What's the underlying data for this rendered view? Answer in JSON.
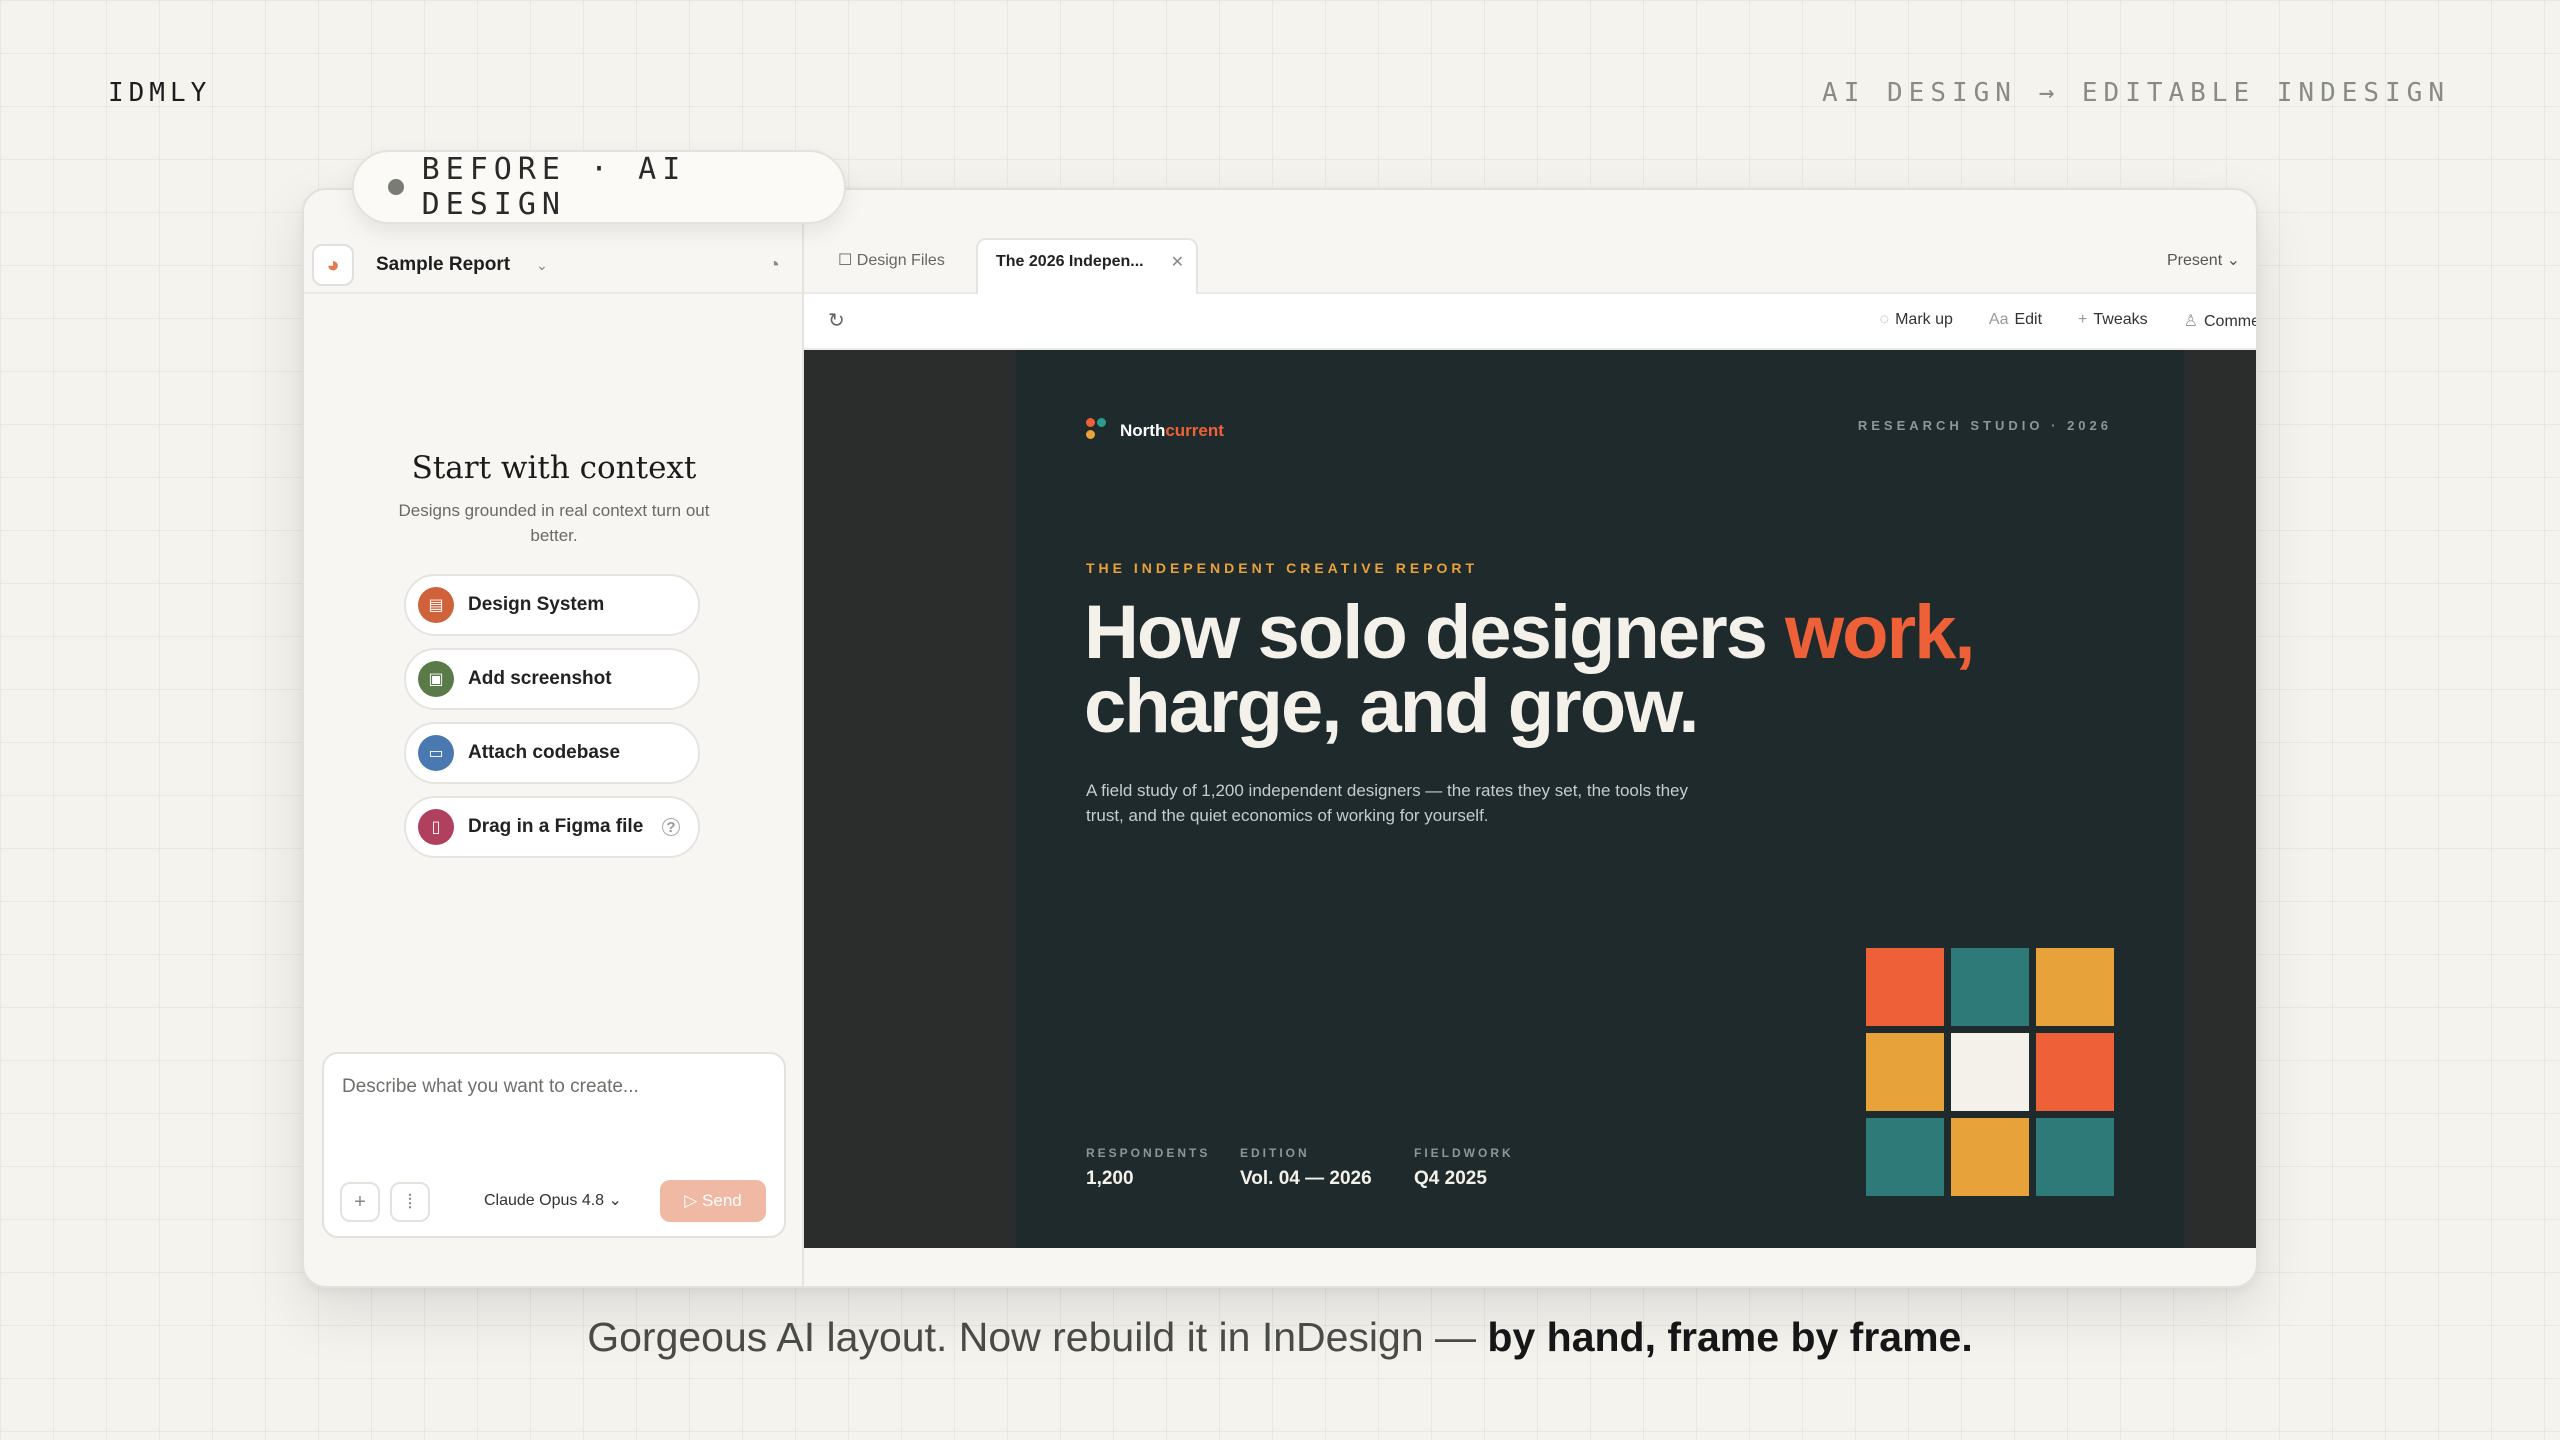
{
  "brand": "IDMLY",
  "tagline": "AI DESIGN → EDITABLE INDESIGN",
  "badge": "BEFORE · AI DESIGN",
  "sidebar": {
    "project_name": "Sample Report",
    "context_title": "Start with context",
    "context_subtitle": "Designs grounded in real context turn out better.",
    "items": [
      {
        "label": "Design System",
        "icon": "design-system-icon",
        "color": "#d0623b"
      },
      {
        "label": "Add screenshot",
        "icon": "image-icon",
        "color": "#5a7a4a"
      },
      {
        "label": "Attach codebase",
        "icon": "code-icon",
        "color": "#4a78b0"
      },
      {
        "label": "Drag in a Figma file",
        "icon": "file-icon",
        "color": "#b0405e"
      }
    ],
    "composer_placeholder": "Describe what you want to create...",
    "model": "Claude Opus 4.8",
    "send": "Send"
  },
  "tabs": {
    "files": "Design Files",
    "active": "The 2026 Indepen...",
    "present": "Present"
  },
  "toolbar": {
    "markup": "Mark up",
    "edit": "Edit",
    "tweaks": "Tweaks",
    "comment": "Comme"
  },
  "slide": {
    "logo_a": "North",
    "logo_b": "current",
    "studio": "RESEARCH STUDIO · 2026",
    "kicker": "THE INDEPENDENT CREATIVE REPORT",
    "headline_line1": "How solo designers ",
    "headline_accent": "work,",
    "headline_line2": "charge, and grow.",
    "lede": "A field study of 1,200 independent designers — the rates they set, the tools they trust, and the quiet economics of working for yourself.",
    "stats": [
      {
        "label": "RESPONDENTS",
        "value": "1,200"
      },
      {
        "label": "EDITION",
        "value": "Vol. 04 — 2026"
      },
      {
        "label": "FIELDWORK",
        "value": "Q4 2025"
      }
    ],
    "tile_colors": [
      "#ee6138",
      "#2e7a78",
      "#e8a23a",
      "#e8a23a",
      "#f4f1ea",
      "#ee6138",
      "#2e7a78",
      "#e8a23a",
      "#2e7a78"
    ]
  },
  "caption": {
    "normal": "Gorgeous AI layout. Now rebuild it in InDesign — ",
    "bold": "by hand, frame by frame."
  }
}
